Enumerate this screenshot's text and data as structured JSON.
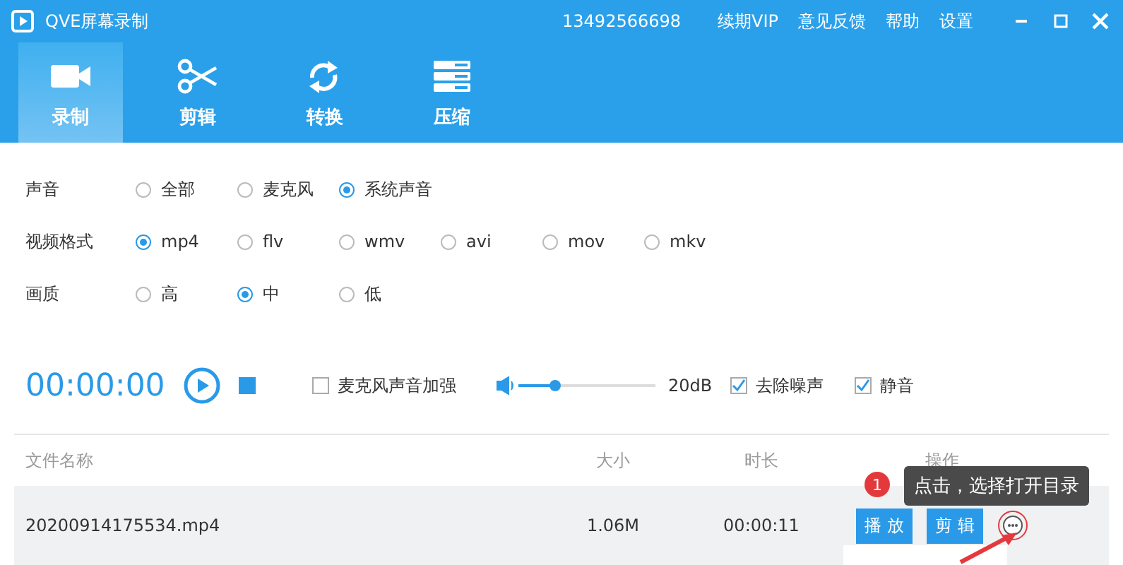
{
  "window": {
    "title": "QVE屏幕录制",
    "account": "13492566698",
    "links": [
      "续期VIP",
      "意见反馈",
      "帮助",
      "设置"
    ]
  },
  "tabs": [
    {
      "label": "录制",
      "selected": true
    },
    {
      "label": "剪辑",
      "selected": false
    },
    {
      "label": "转换",
      "selected": false
    },
    {
      "label": "压缩",
      "selected": false
    }
  ],
  "settings": [
    {
      "label": "声音",
      "options": [
        {
          "label": "全部",
          "selected": false
        },
        {
          "label": "麦克风",
          "selected": false
        },
        {
          "label": "系统声音",
          "selected": true
        }
      ]
    },
    {
      "label": "视频格式",
      "options": [
        {
          "label": "mp4",
          "selected": true
        },
        {
          "label": "flv",
          "selected": false
        },
        {
          "label": "wmv",
          "selected": false
        },
        {
          "label": "avi",
          "selected": false
        },
        {
          "label": "mov",
          "selected": false
        },
        {
          "label": "mkv",
          "selected": false
        }
      ]
    },
    {
      "label": "画质",
      "options": [
        {
          "label": "高",
          "selected": false
        },
        {
          "label": "中",
          "selected": true
        },
        {
          "label": "低",
          "selected": false
        }
      ]
    }
  ],
  "recorder": {
    "time": "00:00:00",
    "mic_boost": {
      "label": "麦克风声音加强",
      "checked": false
    },
    "volume": {
      "level": 0.27,
      "reading": "20dB"
    },
    "options": [
      {
        "label": "去除噪声",
        "checked": true
      },
      {
        "label": "静音",
        "checked": true
      }
    ]
  },
  "table": {
    "columns": [
      "文件名称",
      "大小",
      "时长",
      "操作"
    ],
    "rows": [
      {
        "cells": [
          "20200914175534.mp4",
          "1.06M",
          "00:00:11"
        ],
        "actions": [
          "播 放",
          "剪 辑"
        ]
      }
    ]
  },
  "tooltip": {
    "badge": "1",
    "text": "点击，选择打开目录"
  }
}
